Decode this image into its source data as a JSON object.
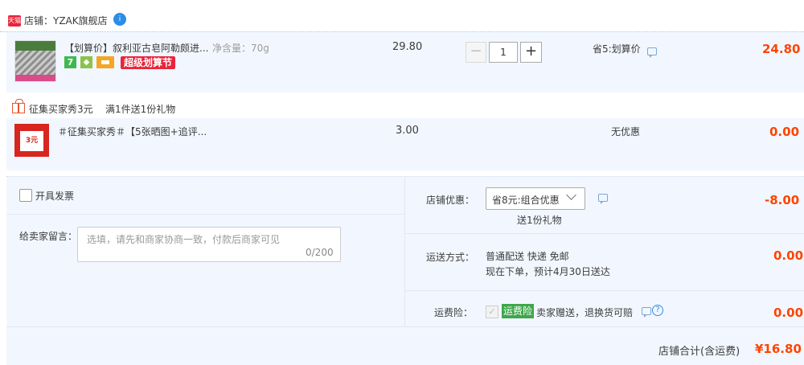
{
  "shop": {
    "badge": "天猫",
    "label": "店铺：YZAK旗舰店",
    "wangwang_badge": "i"
  },
  "item": {
    "title": "【划算价】叙利亚古皂阿勒颇进...",
    "spec": "净含量：70g",
    "service_icons": [
      "seven-day-return-icon",
      "guarantee-icon",
      "card-icon"
    ],
    "icon_7": "7",
    "promo_tag": "超级划算节",
    "unit_price": "29.80",
    "quantity": "1",
    "qty_minus": "−",
    "qty_plus": "+",
    "discount": "省5:划算价",
    "subtotal": "24.80"
  },
  "gift": {
    "header": "征集买家秀3元",
    "rule": "满1件送1份礼物",
    "thumb_text": "3元",
    "title": "＃征集买家秀＃【5张晒图+追评...",
    "unit_price": "3.00",
    "discount": "无优惠",
    "subtotal": "0.00"
  },
  "order_options": {
    "invoice_label": "开具发票",
    "note_label": "给卖家留言：",
    "note_placeholder": "选填，请先和商家协商一致，付款后商家可见",
    "note_count": "0/200",
    "shop_discount_label": "店铺优惠：",
    "shop_discount_value": "省8元:组合优惠",
    "gift_note": "送1份礼物",
    "shop_discount_amount": "-8.00",
    "shipping_label": "运送方式：",
    "shipping_method": "普通配送 快递 免邮",
    "shipping_eta": "现在下单，预计4月30日送达",
    "shipping_fee": "0.00",
    "insurance_label": "运费险：",
    "insurance_check": "✓",
    "insurance_badge": "运费险",
    "insurance_desc": "卖家赠送，退换货可赔",
    "insurance_help": "?",
    "insurance_amount": "0.00",
    "total_label": "店铺合计(含运费)",
    "total_amount": "¥16.80"
  },
  "colors": {
    "accent_price": "#ff4400",
    "row_bg": "#f2f7ff",
    "tmall_red": "#e8253b",
    "insurance_green": "#3fa64b"
  }
}
